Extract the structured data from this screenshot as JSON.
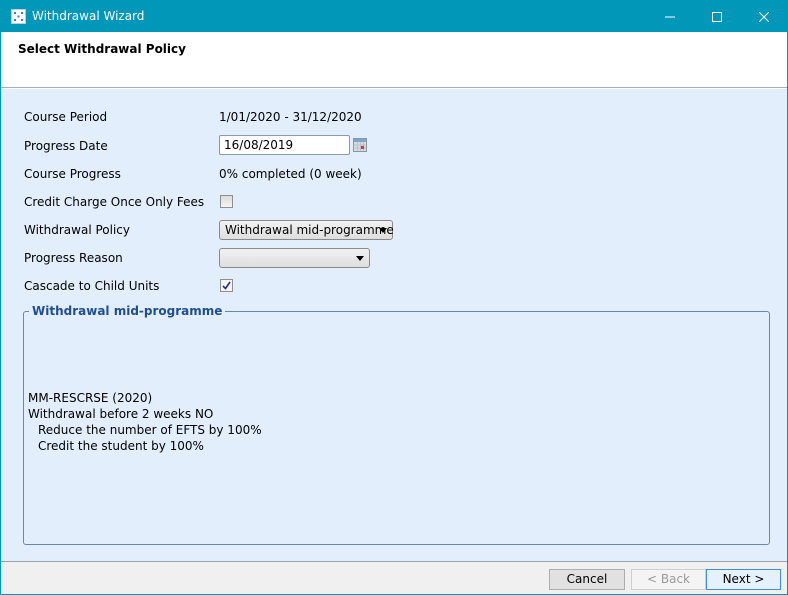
{
  "window": {
    "title": "Withdrawal Wizard",
    "controls": {
      "minimize": "minimize",
      "maximize": "maximize",
      "close": "close"
    },
    "accent_color": "#0097b8"
  },
  "header": {
    "title": "Select Withdrawal Policy"
  },
  "form": {
    "course_period": {
      "label": "Course Period",
      "value": "1/01/2020 - 31/12/2020"
    },
    "progress_date": {
      "label": "Progress Date",
      "value": "16/08/2019"
    },
    "course_progress": {
      "label": "Course Progress",
      "value": "0% completed (0 week)"
    },
    "credit_charge": {
      "label": "Credit Charge Once Only Fees",
      "checked": false
    },
    "withdrawal_policy": {
      "label": "Withdrawal Policy",
      "selected": "Withdrawal mid-programme"
    },
    "progress_reason": {
      "label": "Progress Reason",
      "selected": ""
    },
    "cascade": {
      "label": "Cascade to Child Units",
      "checked": true
    }
  },
  "policy_group": {
    "title": "Withdrawal mid-programme",
    "lines": [
      "MM-RESCRSE (2020)",
      "Withdrawal before 2 weeks NO",
      "Reduce the number of EFTS by 100%",
      "Credit the student by 100%"
    ]
  },
  "footer": {
    "cancel_label": "Cancel",
    "back_label": "< Back",
    "next_label": "Next >"
  }
}
